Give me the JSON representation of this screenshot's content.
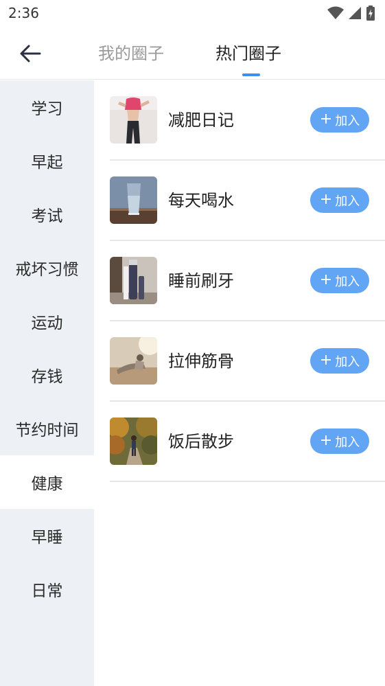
{
  "status_bar": {
    "time": "2:36",
    "icons": [
      "wifi-icon",
      "cell-signal-icon",
      "battery-charging-icon"
    ]
  },
  "header": {
    "back_icon": "arrow-left-icon",
    "tabs": [
      {
        "label": "我的圈子",
        "active": false
      },
      {
        "label": "热门圈子",
        "active": true
      }
    ],
    "accent_color": "#3b8ff3"
  },
  "sidebar": {
    "items": [
      {
        "label": "学习",
        "active": false
      },
      {
        "label": "早起",
        "active": false
      },
      {
        "label": "考试",
        "active": false
      },
      {
        "label": "戒坏习惯",
        "active": false
      },
      {
        "label": "运动",
        "active": false
      },
      {
        "label": "存钱",
        "active": false
      },
      {
        "label": "节约时间",
        "active": false
      },
      {
        "label": "健康",
        "active": true
      },
      {
        "label": "早睡",
        "active": false
      },
      {
        "label": "日常",
        "active": false
      }
    ],
    "background": "#edf1f5"
  },
  "circles": [
    {
      "title": "减肥日记",
      "button": "加入",
      "image": "fitness-photo"
    },
    {
      "title": "每天喝水",
      "button": "加入",
      "image": "water-glass-photo"
    },
    {
      "title": "睡前刷牙",
      "button": "加入",
      "image": "toothpaste-photo"
    },
    {
      "title": "拉伸筋骨",
      "button": "加入",
      "image": "stretching-photo"
    },
    {
      "title": "饭后散步",
      "button": "加入",
      "image": "walking-photo"
    }
  ],
  "join_button_color": "#62a5f4"
}
